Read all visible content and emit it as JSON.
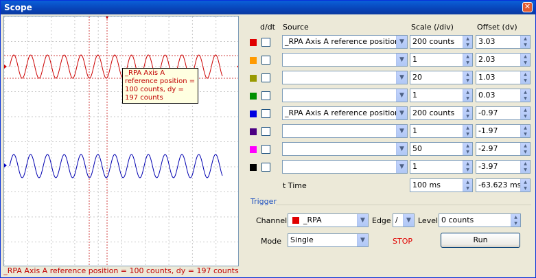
{
  "window": {
    "title": "Scope",
    "close_glyph": "✕"
  },
  "status_text": "_RPA Axis A reference position = 100 counts, dy = 197 counts",
  "tooltip_text": "_RPA Axis A reference position = 100 counts, dy = 197 counts",
  "headers": {
    "ddt": "d/dt",
    "source": "Source",
    "scale": "Scale (/div)",
    "offset": "Offset (dv)"
  },
  "channels": [
    {
      "color": "#e00000",
      "source": "_RPA Axis A reference position",
      "scale": "200 counts",
      "offset": "3.03"
    },
    {
      "color": "#ff9a00",
      "source": "",
      "scale": "1",
      "offset": "2.03"
    },
    {
      "color": "#999900",
      "source": "",
      "scale": "20",
      "offset": "1.03"
    },
    {
      "color": "#009000",
      "source": "",
      "scale": "1",
      "offset": "0.03"
    },
    {
      "color": "#0000e0",
      "source": "_RPA Axis A reference position",
      "scale": "200 counts",
      "offset": "-0.97"
    },
    {
      "color": "#4b0082",
      "source": "",
      "scale": "1",
      "offset": "-1.97"
    },
    {
      "color": "#ff00ff",
      "source": "",
      "scale": "50",
      "offset": "-2.97"
    },
    {
      "color": "#000000",
      "source": "",
      "scale": "1",
      "offset": "-3.97"
    }
  ],
  "time": {
    "label": "t Time",
    "scale": "100 ms",
    "offset": "-63.623 ms"
  },
  "trigger": {
    "title": "Trigger",
    "channel_label": "Channel",
    "channel_value": "_RPA",
    "channel_color": "#e00000",
    "edge_label": "Edge",
    "edge_value": "/",
    "level_label": "Level",
    "level_value": "0 counts",
    "mode_label": "Mode",
    "mode_value": "Single",
    "state": "STOP",
    "run_label": "Run"
  },
  "accent": {
    "trigger_title": "#1c4fbf",
    "stop": "#e00000",
    "trace_red": "#cc0000",
    "trace_blue": "#0000b0"
  }
}
